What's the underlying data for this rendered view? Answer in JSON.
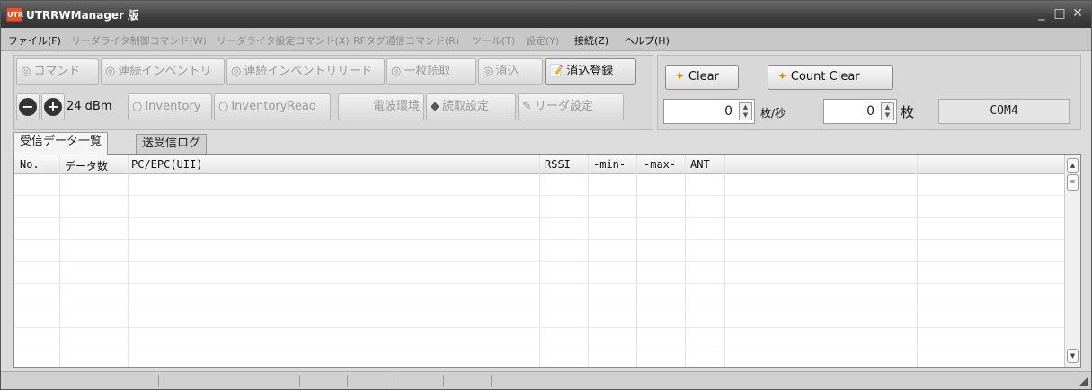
{
  "window": {
    "title": "UTRRWManager 版",
    "icon_text": "UTR",
    "controls": {
      "minimize": "_",
      "maximize": "□",
      "close": "✕"
    }
  },
  "menu": [
    {
      "label": "ファイル(F)",
      "enabled": true
    },
    {
      "label": "リーダライタ制御コマンド(W)",
      "enabled": false
    },
    {
      "label": "リーダライタ設定コマンド(X)",
      "enabled": false
    },
    {
      "label": "RFタグ通信コマンド(R)",
      "enabled": false
    },
    {
      "label": "ツール(T)",
      "enabled": false
    },
    {
      "label": "設定(Y)",
      "enabled": false
    },
    {
      "label": "接続(Z)",
      "enabled": true
    },
    {
      "label": "ヘルプ(H)",
      "enabled": true
    }
  ],
  "toolbar": {
    "row1": [
      {
        "label": "コマンド",
        "icon": "◎",
        "enabled": false
      },
      {
        "label": "連続インベントリ",
        "icon": "◎",
        "enabled": false
      },
      {
        "label": "連続インベントリリード",
        "icon": "◎",
        "enabled": false
      },
      {
        "label": "一枚読取",
        "icon": "◎",
        "enabled": false
      },
      {
        "label": "消込",
        "icon": "◎",
        "enabled": false
      },
      {
        "label": "消込登録",
        "icon": "📝",
        "enabled": true
      }
    ],
    "power": {
      "minus": "−",
      "plus": "+",
      "value": "24 dBm"
    },
    "row2": [
      {
        "label": "Inventory",
        "icon": "○",
        "enabled": false
      },
      {
        "label": "InventoryRead",
        "icon": "○",
        "enabled": false
      },
      {
        "label": "電波環境",
        "icon": "",
        "enabled": false
      },
      {
        "label": "読取設定",
        "icon": "◆",
        "enabled": false
      },
      {
        "label": "リーダ設定",
        "icon": "✎",
        "enabled": false
      }
    ]
  },
  "right_panel": {
    "clear_label": "Clear",
    "count_clear_label": "Count Clear",
    "rate_value": "0",
    "rate_unit": "枚/秒",
    "count_value": "0",
    "count_unit": "枚",
    "port": "COM4"
  },
  "tabs": [
    {
      "label": "受信データ一覧",
      "active": true
    },
    {
      "label": "送受信ログ",
      "active": false
    }
  ],
  "grid": {
    "columns": [
      "No.",
      "データ数",
      "PC/EPC(UII)",
      "RSSI",
      "-min-",
      "-max-",
      "ANT",
      "",
      ""
    ],
    "rows": []
  }
}
